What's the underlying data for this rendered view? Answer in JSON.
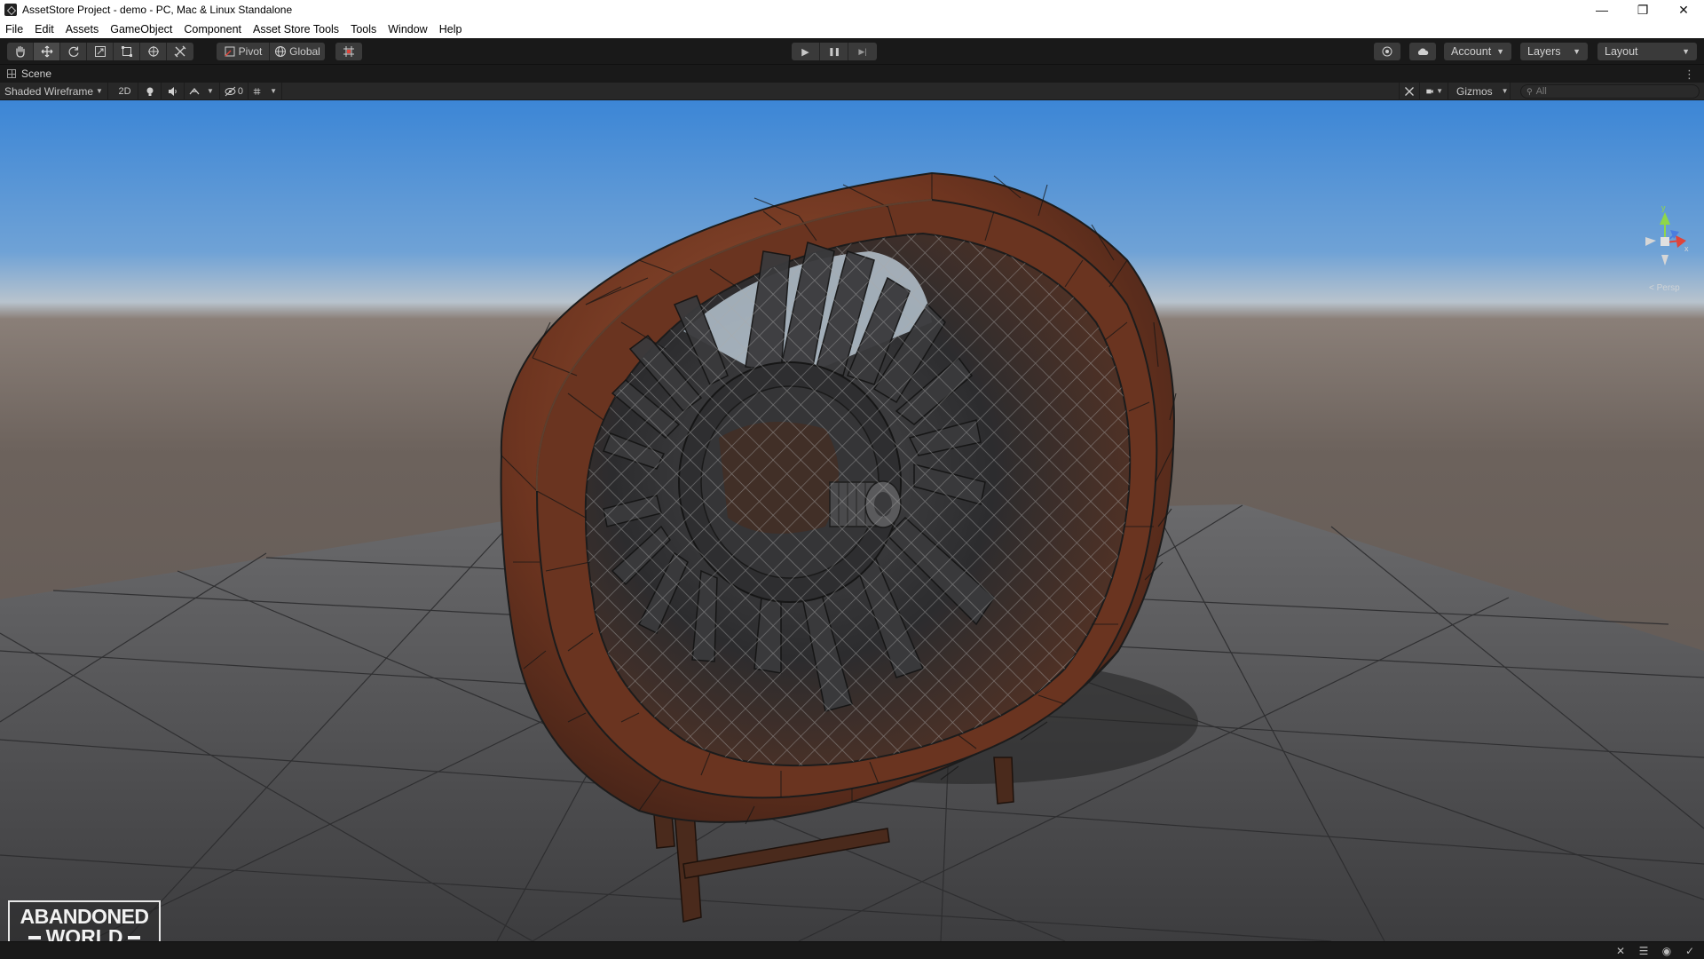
{
  "window": {
    "title": "AssetStore Project - demo - PC, Mac & Linux Standalone",
    "controls": {
      "minimize": "—",
      "restore": "❐",
      "close": "✕"
    }
  },
  "menu": [
    "File",
    "Edit",
    "Assets",
    "GameObject",
    "Component",
    "Asset Store Tools",
    "Tools",
    "Window",
    "Help"
  ],
  "toolbar": {
    "tools": [
      {
        "name": "hand-tool",
        "icon": "hand-icon"
      },
      {
        "name": "move-tool",
        "icon": "move-arrows-icon",
        "active": true
      },
      {
        "name": "rotate-tool",
        "icon": "rotate-icon"
      },
      {
        "name": "scale-tool",
        "icon": "scale-icon"
      },
      {
        "name": "rect-tool",
        "icon": "rect-icon"
      },
      {
        "name": "transform-tool",
        "icon": "transform-icon"
      },
      {
        "name": "custom-tool",
        "icon": "tools-icon"
      }
    ],
    "pivot_label": "Pivot",
    "global_label": "Global",
    "play_icon": "▶",
    "pause_icon": "❚❚",
    "step_icon": "▶|",
    "account_label": "Account",
    "layers_label": "Layers",
    "layout_label": "Layout"
  },
  "scene": {
    "tab_label": "Scene",
    "shading_mode": "Shaded Wireframe",
    "mode_2d": "2D",
    "hidden_count": "0",
    "gizmos_label": "Gizmos",
    "search_placeholder": "All"
  },
  "gizmo": {
    "y_label": "y",
    "x_label": "x",
    "projection_label": "< Persp",
    "colors": {
      "y": "#8fd64a",
      "x": "#e0443a",
      "z": "#4a7de0",
      "neutral": "#d6d6d6"
    }
  },
  "watermark": {
    "line1": "ABANDONED",
    "line2": "WORLD"
  },
  "colors": {
    "sky_top": "#3e87d6",
    "sky_horizon": "#b9c6d3",
    "ground": "#5a5a5c",
    "rust": "#7a3a24",
    "dark_metal": "#2c2c2e"
  }
}
